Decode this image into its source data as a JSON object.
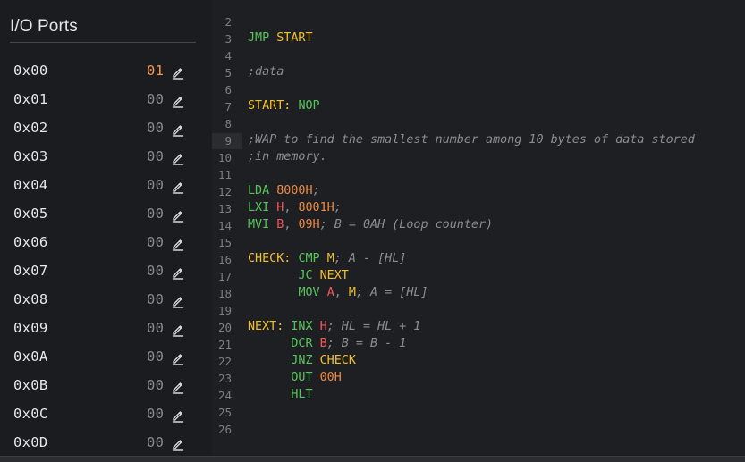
{
  "panel": {
    "title": "I/O Ports",
    "edit_icon": "pencil-icon",
    "ports": [
      {
        "address": "0x00",
        "value": "01",
        "active": true
      },
      {
        "address": "0x01",
        "value": "00",
        "active": false
      },
      {
        "address": "0x02",
        "value": "00",
        "active": false
      },
      {
        "address": "0x03",
        "value": "00",
        "active": false
      },
      {
        "address": "0x04",
        "value": "00",
        "active": false
      },
      {
        "address": "0x05",
        "value": "00",
        "active": false
      },
      {
        "address": "0x06",
        "value": "00",
        "active": false
      },
      {
        "address": "0x07",
        "value": "00",
        "active": false
      },
      {
        "address": "0x08",
        "value": "00",
        "active": false
      },
      {
        "address": "0x09",
        "value": "00",
        "active": false
      },
      {
        "address": "0x0A",
        "value": "00",
        "active": false
      },
      {
        "address": "0x0B",
        "value": "00",
        "active": false
      },
      {
        "address": "0x0C",
        "value": "00",
        "active": false
      },
      {
        "address": "0x0D",
        "value": "00",
        "active": false
      }
    ]
  },
  "editor": {
    "active_line": "9",
    "colors": {
      "label": "#f2c02d",
      "mnemonic": "#56c55a",
      "register": "#ee5a5a",
      "number": "#f08a42",
      "comment": "#8a8d93",
      "active_port_value": "#ef9a4e"
    },
    "lines": [
      {
        "n": "2",
        "tokens": []
      },
      {
        "n": "3",
        "tokens": [
          {
            "t": "JMP",
            "k": "op"
          },
          {
            "t": " "
          },
          {
            "t": "START",
            "k": "kw"
          }
        ]
      },
      {
        "n": "4",
        "tokens": []
      },
      {
        "n": "5",
        "tokens": [
          {
            "t": ";data",
            "k": "cm"
          }
        ]
      },
      {
        "n": "6",
        "tokens": []
      },
      {
        "n": "7",
        "tokens": [
          {
            "t": "START:",
            "k": "kw"
          },
          {
            "t": " "
          },
          {
            "t": "NOP",
            "k": "op"
          }
        ]
      },
      {
        "n": "8",
        "tokens": []
      },
      {
        "n": "9",
        "tokens": [
          {
            "t": ";WAP to find the smallest number among 10 bytes of data stored",
            "k": "cm"
          }
        ]
      },
      {
        "n": "10",
        "tokens": [
          {
            "t": ";in memory.",
            "k": "cm"
          }
        ]
      },
      {
        "n": "11",
        "tokens": []
      },
      {
        "n": "12",
        "tokens": [
          {
            "t": "LDA",
            "k": "op"
          },
          {
            "t": " "
          },
          {
            "t": "8000H",
            "k": "num"
          },
          {
            "t": ";",
            "k": "cm"
          }
        ]
      },
      {
        "n": "13",
        "tokens": [
          {
            "t": "LXI",
            "k": "op"
          },
          {
            "t": " "
          },
          {
            "t": "H",
            "k": "reg"
          },
          {
            "t": ", ",
            "k": "pn"
          },
          {
            "t": "8001H",
            "k": "num"
          },
          {
            "t": ";",
            "k": "cm"
          }
        ]
      },
      {
        "n": "14",
        "tokens": [
          {
            "t": "MVI",
            "k": "op"
          },
          {
            "t": " "
          },
          {
            "t": "B",
            "k": "reg"
          },
          {
            "t": ", ",
            "k": "pn"
          },
          {
            "t": "09H",
            "k": "num"
          },
          {
            "t": "; B = 0AH (Loop counter)",
            "k": "cm"
          }
        ]
      },
      {
        "n": "15",
        "tokens": []
      },
      {
        "n": "16",
        "tokens": [
          {
            "t": "CHECK:",
            "k": "kw"
          },
          {
            "t": " "
          },
          {
            "t": "CMP",
            "k": "op"
          },
          {
            "t": " "
          },
          {
            "t": "M",
            "k": "kw"
          },
          {
            "t": "; A - [HL]",
            "k": "cm"
          }
        ]
      },
      {
        "n": "17",
        "tokens": [
          {
            "t": "       "
          },
          {
            "t": "JC",
            "k": "op"
          },
          {
            "t": " "
          },
          {
            "t": "NEXT",
            "k": "kw"
          }
        ]
      },
      {
        "n": "18",
        "tokens": [
          {
            "t": "       "
          },
          {
            "t": "MOV",
            "k": "op"
          },
          {
            "t": " "
          },
          {
            "t": "A",
            "k": "reg"
          },
          {
            "t": ", ",
            "k": "pn"
          },
          {
            "t": "M",
            "k": "kw"
          },
          {
            "t": "; A = [HL]",
            "k": "cm"
          }
        ]
      },
      {
        "n": "19",
        "tokens": []
      },
      {
        "n": "20",
        "tokens": [
          {
            "t": "NEXT:",
            "k": "kw"
          },
          {
            "t": " "
          },
          {
            "t": "INX",
            "k": "op"
          },
          {
            "t": " "
          },
          {
            "t": "H",
            "k": "reg"
          },
          {
            "t": "; HL = HL + 1",
            "k": "cm"
          }
        ]
      },
      {
        "n": "21",
        "tokens": [
          {
            "t": "      "
          },
          {
            "t": "DCR",
            "k": "op"
          },
          {
            "t": " "
          },
          {
            "t": "B",
            "k": "reg"
          },
          {
            "t": "; B = B - 1",
            "k": "cm"
          }
        ]
      },
      {
        "n": "22",
        "tokens": [
          {
            "t": "      "
          },
          {
            "t": "JNZ",
            "k": "op"
          },
          {
            "t": " "
          },
          {
            "t": "CHECK",
            "k": "kw"
          }
        ]
      },
      {
        "n": "23",
        "tokens": [
          {
            "t": "      "
          },
          {
            "t": "OUT",
            "k": "op"
          },
          {
            "t": " "
          },
          {
            "t": "00H",
            "k": "num"
          }
        ]
      },
      {
        "n": "24",
        "tokens": [
          {
            "t": "      "
          },
          {
            "t": "HLT",
            "k": "op"
          }
        ]
      },
      {
        "n": "25",
        "tokens": []
      },
      {
        "n": "26",
        "tokens": []
      }
    ]
  }
}
